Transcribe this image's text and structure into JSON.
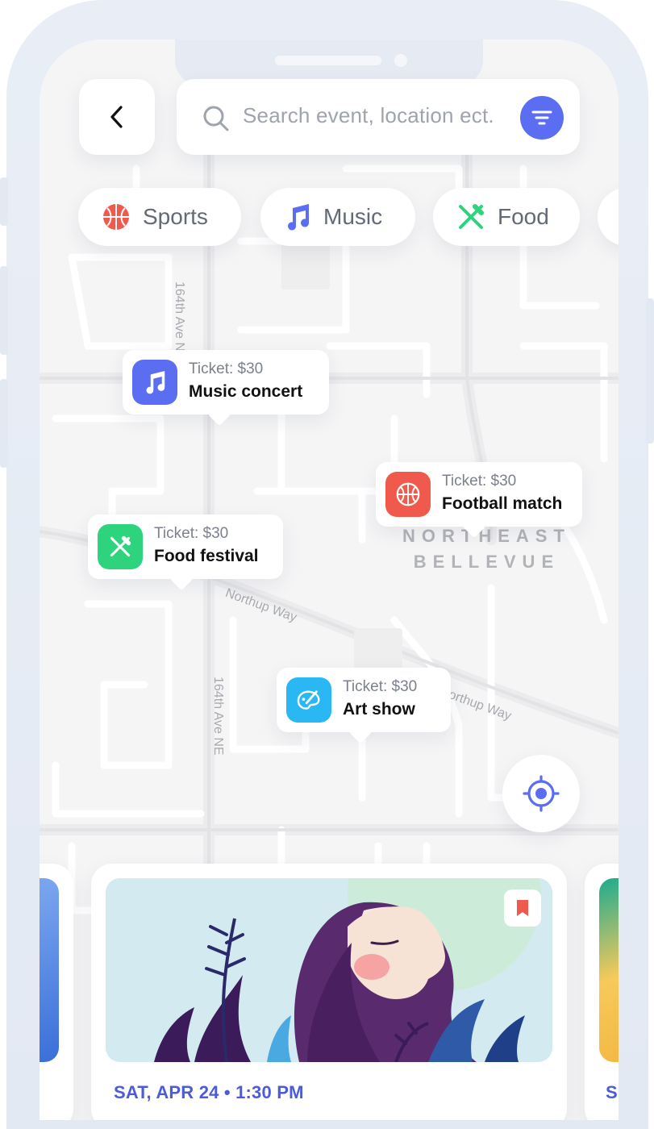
{
  "search": {
    "placeholder": "Search event, location ect."
  },
  "categories": [
    {
      "label": "Sports",
      "icon": "basketball-icon",
      "color": "#ef5a4c"
    },
    {
      "label": "Music",
      "icon": "music-note-icon",
      "color": "#5b6df0"
    },
    {
      "label": "Food",
      "icon": "fork-knife-icon",
      "color": "#2ed37e"
    }
  ],
  "map": {
    "street_labels": [
      "164th Ave NE",
      "Northup Way",
      "Northup Way",
      "164th Ave NE"
    ],
    "area_label": {
      "line1": "NORTHEAST",
      "line2": "BELLEVUE"
    }
  },
  "pins": [
    {
      "price": "Ticket: $30",
      "title": "Music concert",
      "icon": "music-note-icon",
      "color": "#5b6df0"
    },
    {
      "price": "Ticket: $30",
      "title": "Football match",
      "icon": "basketball-icon",
      "color": "#ef5a4c"
    },
    {
      "price": "Ticket: $30",
      "title": "Food festival",
      "icon": "fork-knife-icon",
      "color": "#2ed37e"
    },
    {
      "price": "Ticket: $30",
      "title": "Art show",
      "icon": "paint-palette-icon",
      "color": "#2ab8f5"
    }
  ],
  "event_card": {
    "date": "SAT, APR 24 • 1:30 PM"
  },
  "next_card": {
    "date": "S"
  },
  "colors": {
    "accent": "#5b6df0",
    "date_text": "#4b5bd9",
    "bookmark": "#ef5a4c"
  }
}
